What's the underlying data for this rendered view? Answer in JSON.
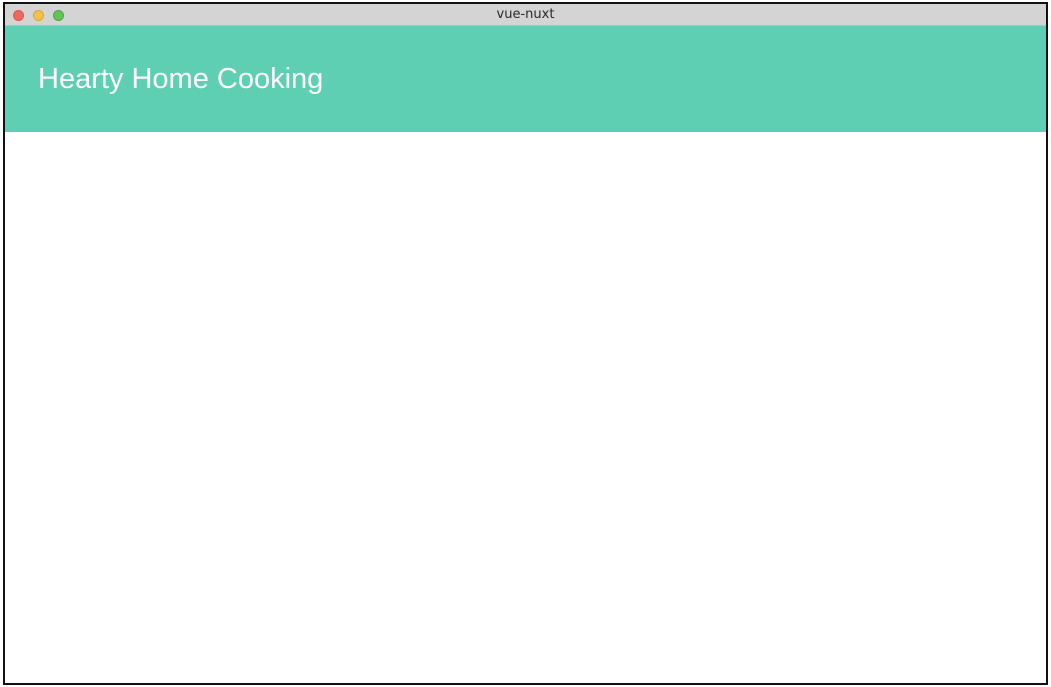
{
  "window": {
    "title": "vue-nuxt"
  },
  "header": {
    "title": "Hearty Home Cooking",
    "background_color": "#5ecfb2",
    "text_color": "#ffffff"
  },
  "traffic_lights": {
    "close_color": "#ee6a5f",
    "minimize_color": "#f5bf4f",
    "maximize_color": "#62c554"
  }
}
